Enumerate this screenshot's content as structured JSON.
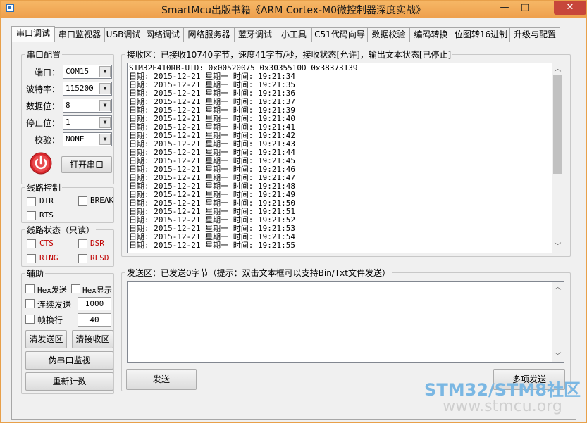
{
  "window": {
    "title": "SmartMcu出版书籍《ARM Cortex-M0微控制器深度实战》",
    "minimize": "—",
    "maximize": "□",
    "close": "✕"
  },
  "tabs": [
    {
      "label": "串口调试",
      "active": true
    },
    {
      "label": "串口监视器"
    },
    {
      "label": "USB调试"
    },
    {
      "label": "网络调试"
    },
    {
      "label": "网络服务器"
    },
    {
      "label": "蓝牙调试"
    },
    {
      "label": "小工具"
    },
    {
      "label": "C51代码向导"
    },
    {
      "label": "数据校验"
    },
    {
      "label": "编码转换"
    },
    {
      "label": "位图转16进制"
    },
    {
      "label": "升级与配置"
    }
  ],
  "serial_config": {
    "title": "串口配置",
    "port_label": "端口：",
    "port_value": "COM15",
    "baud_label": "波特率：",
    "baud_value": "115200",
    "databits_label": "数据位：",
    "databits_value": "8",
    "stopbits_label": "停止位：",
    "stopbits_value": "1",
    "parity_label": "校验：",
    "parity_value": "NONE",
    "open_button": "打开串口"
  },
  "line_control": {
    "title": "线路控制",
    "dtr": "DTR",
    "break": "BREAK",
    "rts": "RTS"
  },
  "line_status": {
    "title": "线路状态（只读）",
    "cts": "CTS",
    "dsr": "DSR",
    "ring": "RING",
    "rlsd": "RLSD"
  },
  "assist": {
    "title": "辅助",
    "hex_send": "Hex发送",
    "hex_display": "Hex显示",
    "continuous_send": "连续发送",
    "continuous_value": "1000",
    "frame_newline": "帧换行",
    "frame_value": "40",
    "clear_send": "清发送区",
    "clear_receive": "清接收区",
    "pseudo_monitor": "伪串口监视",
    "reset_count": "重新计数"
  },
  "receive": {
    "title": "接收区：已接收10740字节，速度41字节/秒，接收状态[允许]，输出文本状态[已停止]",
    "lines": [
      "STM32F410RB-UID: 0x00520075 0x3035510D 0x38373139",
      "日期: 2015-12-21 星期一 时间: 19:21:34",
      "日期: 2015-12-21 星期一 时间: 19:21:35",
      "日期: 2015-12-21 星期一 时间: 19:21:36",
      "日期: 2015-12-21 星期一 时间: 19:21:37",
      "日期: 2015-12-21 星期一 时间: 19:21:39",
      "日期: 2015-12-21 星期一 时间: 19:21:40",
      "日期: 2015-12-21 星期一 时间: 19:21:41",
      "日期: 2015-12-21 星期一 时间: 19:21:42",
      "日期: 2015-12-21 星期一 时间: 19:21:43",
      "日期: 2015-12-21 星期一 时间: 19:21:44",
      "日期: 2015-12-21 星期一 时间: 19:21:45",
      "日期: 2015-12-21 星期一 时间: 19:21:46",
      "日期: 2015-12-21 星期一 时间: 19:21:47",
      "日期: 2015-12-21 星期一 时间: 19:21:48",
      "日期: 2015-12-21 星期一 时间: 19:21:49",
      "日期: 2015-12-21 星期一 时间: 19:21:50",
      "日期: 2015-12-21 星期一 时间: 19:21:51",
      "日期: 2015-12-21 星期一 时间: 19:21:52",
      "日期: 2015-12-21 星期一 时间: 19:21:53",
      "日期: 2015-12-21 星期一 时间: 19:21:54",
      "日期: 2015-12-21 星期一 时间: 19:21:55"
    ]
  },
  "send": {
    "title": "发送区：已发送0字节（提示：双击文本框可以支持Bin/Txt文件发送）",
    "text": "",
    "send_button": "发送",
    "multi_send_button": "多项发送"
  },
  "watermark": {
    "line1": "STM32/STM8社区",
    "line2": "www.stmcu.org"
  },
  "colors": {
    "titlebar": "#eea04d",
    "close": "#c7463a",
    "status_red": "#c00000",
    "power_button": "#d8262b"
  }
}
